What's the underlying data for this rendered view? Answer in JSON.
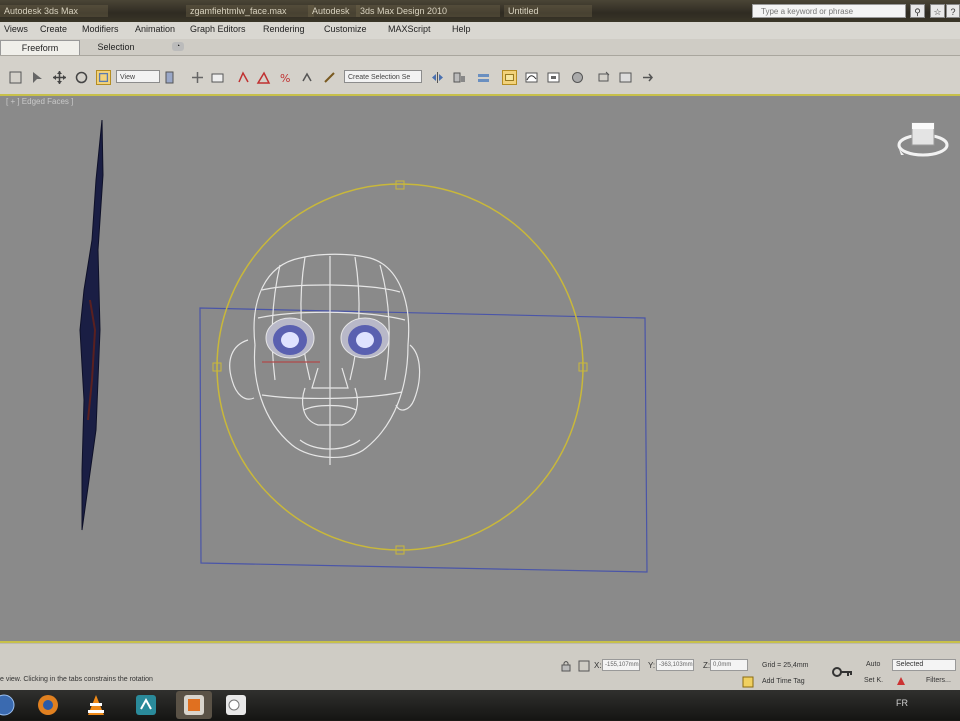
{
  "titlebar": {
    "segments": [
      "Autodesk 3ds Max",
      "zgamfiehtmlw_face.max",
      "Autodesk",
      "3ds Max Design 2010",
      "Untitled"
    ],
    "search_placeholder": "Type a keyword or phrase"
  },
  "menu": [
    "Views",
    "Create",
    "Modifiers",
    "Animation",
    "Graph Editors",
    "Rendering",
    "Customize",
    "MAXScript",
    "Help"
  ],
  "ribbon": {
    "tabs": [
      "Freeform",
      "Selection"
    ],
    "more": "◔"
  },
  "toolbar": {
    "reference_coord": "View",
    "named_selection": "Create Selection Se"
  },
  "viewport": {
    "label": "[ + ] Edged Faces ]"
  },
  "status": {
    "prompt": "e view. Clicking in the tabs constrains the rotation",
    "x_label": "X:",
    "y_label": "Y:",
    "z_label": "Z:",
    "x_value": "-155,107mm",
    "y_value": "-363,103mm",
    "z_value": "0,0mm",
    "grid": "Grid = 25,4mm",
    "time_tag": "Add Time Tag",
    "auto": "Auto",
    "set_key": "Set K.",
    "selected": "Selected",
    "filters": "Filters..."
  },
  "taskbar": {
    "language": "FR"
  },
  "colors": {
    "viewport_bg": "#8a8a8a",
    "gizmo": "#c9b83a",
    "bbox": "#4a55a8",
    "active_border": "#c7c04a"
  }
}
